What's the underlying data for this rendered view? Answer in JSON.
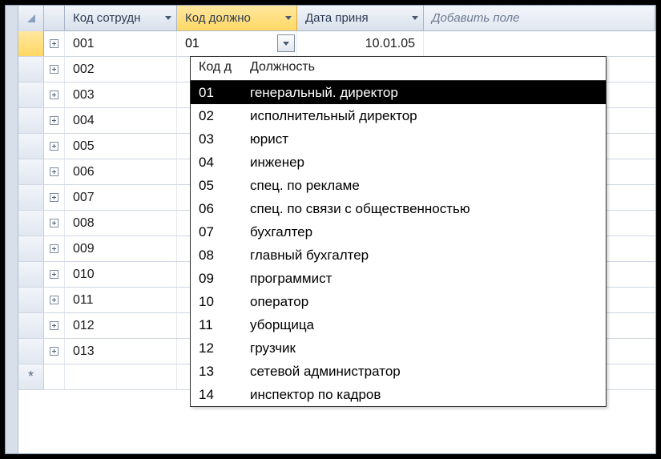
{
  "columns": {
    "employee": "Код сотрудн",
    "position": "Код должно",
    "date": "Дата приня",
    "add": "Добавить поле"
  },
  "rows": [
    {
      "emp": "001",
      "pos_input": "01",
      "date": "10.01.05",
      "selected": true
    },
    {
      "emp": "002"
    },
    {
      "emp": "003"
    },
    {
      "emp": "004"
    },
    {
      "emp": "005"
    },
    {
      "emp": "006"
    },
    {
      "emp": "007"
    },
    {
      "emp": "008"
    },
    {
      "emp": "009"
    },
    {
      "emp": "010"
    },
    {
      "emp": "011"
    },
    {
      "emp": "012"
    },
    {
      "emp": "013"
    }
  ],
  "new_row_marker": "*",
  "dropdown": {
    "header_code": "Код д",
    "header_name": "Должность",
    "selected_index": 0,
    "items": [
      {
        "code": "01",
        "name": "генеральный. директор"
      },
      {
        "code": "02",
        "name": "исполнительный директор"
      },
      {
        "code": "03",
        "name": "юрист"
      },
      {
        "code": "04",
        "name": "инженер"
      },
      {
        "code": "05",
        "name": "спец. по рекламе"
      },
      {
        "code": "06",
        "name": "спец. по связи с общественностью"
      },
      {
        "code": "07",
        "name": "бухгалтер"
      },
      {
        "code": "08",
        "name": "главный бухгалтер"
      },
      {
        "code": "09",
        "name": "программист"
      },
      {
        "code": "10",
        "name": "оператор"
      },
      {
        "code": "11",
        "name": "уборщица"
      },
      {
        "code": "12",
        "name": "грузчик"
      },
      {
        "code": "13",
        "name": "сетевой администратор"
      },
      {
        "code": "14",
        "name": "инспектор по кадров"
      }
    ]
  }
}
